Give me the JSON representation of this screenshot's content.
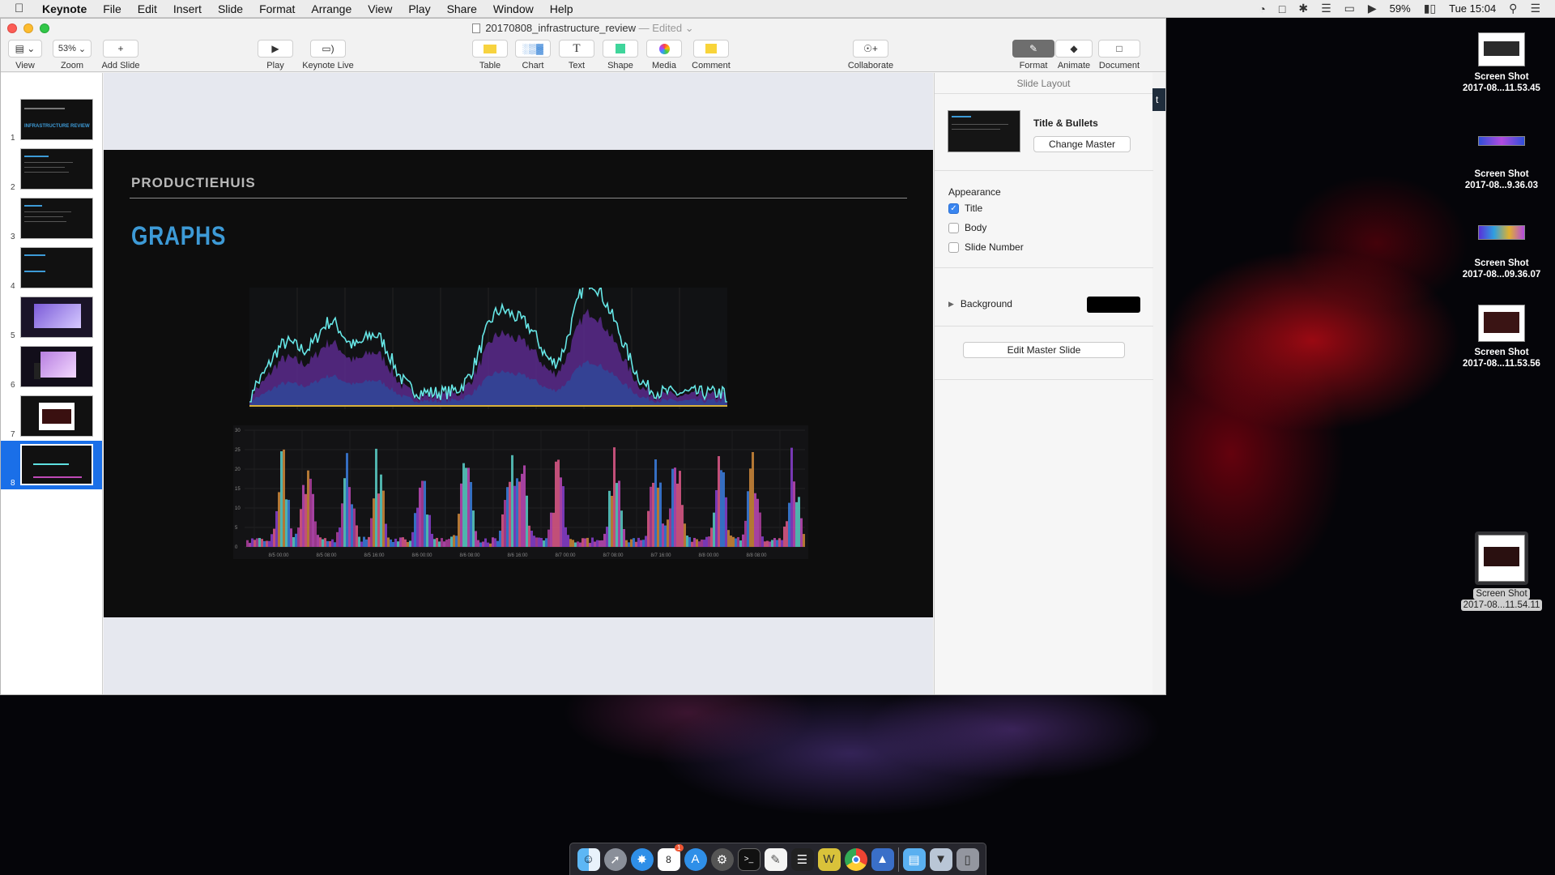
{
  "menubar": {
    "app_name": "Keynote",
    "items": [
      "File",
      "Edit",
      "Insert",
      "Slide",
      "Format",
      "Arrange",
      "View",
      "Play",
      "Share",
      "Window",
      "Help"
    ],
    "battery": "59%",
    "clock": "Tue 15:04"
  },
  "window": {
    "doc_title": "20170808_infrastructure_review",
    "edited_label": "— Edited"
  },
  "toolbar": {
    "view": "View",
    "zoom_value": "53%",
    "zoom": "Zoom",
    "add_slide": "Add Slide",
    "play": "Play",
    "keynote_live": "Keynote Live",
    "table": "Table",
    "chart": "Chart",
    "text": "Text",
    "shape": "Shape",
    "media": "Media",
    "comment": "Comment",
    "collaborate": "Collaborate",
    "format": "Format",
    "animate": "Animate",
    "document": "Document"
  },
  "navigator": {
    "slides": [
      "1",
      "2",
      "3",
      "4",
      "5",
      "6",
      "7",
      "8"
    ],
    "selected_index": 7,
    "slide1_heading": "INFRASTRUCTURE REVIEW"
  },
  "slide": {
    "kicker": "PRODUCTIEHUIS",
    "title": "GRAPHS",
    "title_color": "#3d9ad6",
    "chart2_xticks": [
      "8/5 00:00",
      "8/5 08:00",
      "8/5 16:00",
      "8/6 00:00",
      "8/6 08:00",
      "8/6 16:00",
      "8/7 00:00",
      "8/7 08:00",
      "8/7 16:00",
      "8/8 00:00",
      "8/8 08:00"
    ],
    "chart2_yticks": [
      "30",
      "25",
      "20",
      "15",
      "10",
      "5",
      "0"
    ]
  },
  "inspector": {
    "header": "Slide Layout",
    "master_name": "Title & Bullets",
    "change_master": "Change Master",
    "appearance": "Appearance",
    "checkbox_title": "Title",
    "checkbox_body": "Body",
    "checkbox_slide_number": "Slide Number",
    "title_checked": true,
    "body_checked": false,
    "slide_number_checked": false,
    "background": "Background",
    "background_color": "#000000",
    "edit_master": "Edit Master Slide"
  },
  "desktop": {
    "files": [
      {
        "line1": "Screen Shot",
        "line2": "2017-08...11.53.45"
      },
      {
        "line1": "Screen Shot",
        "line2": "2017-08...9.36.03"
      },
      {
        "line1": "Screen Shot",
        "line2": "2017-08...09.36.07"
      },
      {
        "line1": "Screen Shot",
        "line2": "2017-08...11.53.56"
      },
      {
        "line1": "Screen Shot",
        "line2": "2017-08...11.54.11"
      }
    ]
  },
  "dock": {
    "icons": [
      "finder-icon",
      "launchpad-icon",
      "safari-icon",
      "calendar-icon",
      "app-store-icon",
      "system-preferences-icon",
      "terminal-icon",
      "textedit-icon",
      "activity-monitor-icon",
      "crossover-icon",
      "chrome-icon",
      "keynote-icon",
      "applications-folder-icon",
      "downloads-folder-icon",
      "trash-icon"
    ],
    "calendar_day": "8",
    "calendar_badge": "1"
  }
}
